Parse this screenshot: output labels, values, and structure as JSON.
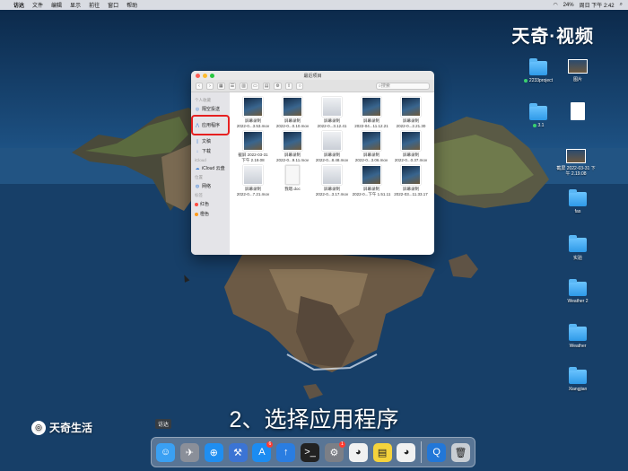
{
  "menubar": {
    "app_name": "访达",
    "items": [
      "文件",
      "编辑",
      "显示",
      "前往",
      "窗口",
      "帮助"
    ],
    "battery": "24%",
    "datetime": "周日 下午 2:42"
  },
  "watermark_top": "天奇·视频",
  "watermark_bottom": "天奇生活",
  "desktop": {
    "items": [
      {
        "label": "2233project"
      },
      {
        "label": "图片"
      },
      {
        "label": "3.1"
      },
      {
        "label": "截屏 2022-03-31 下午 2.19.08"
      },
      {
        "label": "fas"
      },
      {
        "label": "实验"
      },
      {
        "label": "Weather 2"
      },
      {
        "label": "Weather"
      },
      {
        "label": "Xiangjian"
      }
    ]
  },
  "finder": {
    "title": "最近项目",
    "search_placeholder": "搜索",
    "sidebar": {
      "favorites_header": "个人收藏",
      "airdrop": "隔空投送",
      "applications": "应用程序",
      "documents": "文稿",
      "downloads": "下载",
      "icloud_header": "iCloud",
      "icloud_drive": "iCloud 云盘",
      "locations_header": "位置",
      "network": "网络",
      "tags_header": "标签",
      "tag_red": "红色",
      "tag_orange": "橙色"
    },
    "files": [
      {
        "name": "屏幕录制",
        "sub": "2022-0...3.53.mov",
        "kind": "video"
      },
      {
        "name": "屏幕录制",
        "sub": "2022-0...0.10.mov",
        "kind": "video"
      },
      {
        "name": "屏幕录制",
        "sub": "2022-0...3.12.41",
        "kind": "video-light"
      },
      {
        "name": "屏幕录制",
        "sub": "2022-04...11.12.21",
        "kind": "video"
      },
      {
        "name": "屏幕录制",
        "sub": "2022-0...2.21.30",
        "kind": "video"
      },
      {
        "name": "截屏 2022-03-31",
        "sub": "下午 2.19.08",
        "kind": "video"
      },
      {
        "name": "屏幕录制",
        "sub": "2022-0...9.11.mov",
        "kind": "video"
      },
      {
        "name": "屏幕录制",
        "sub": "2022-0...8.48.mov",
        "kind": "video-light"
      },
      {
        "name": "屏幕录制",
        "sub": "2022-0...3.06.mov",
        "kind": "video"
      },
      {
        "name": "屏幕录制",
        "sub": "2022-0...0.37.mov",
        "kind": "video"
      },
      {
        "name": "屏幕录制",
        "sub": "2022-0...7.21.mov",
        "kind": "video-light"
      },
      {
        "name": "我嗯.doc",
        "sub": "",
        "kind": "doc"
      },
      {
        "name": "屏幕录制",
        "sub": "2022-0...3.17.mov",
        "kind": "video-light"
      },
      {
        "name": "屏幕录制",
        "sub": "2022-0...下午 1.51.11",
        "kind": "video"
      },
      {
        "name": "屏幕录制",
        "sub": "2022-03...11.33.17",
        "kind": "video"
      }
    ]
  },
  "subtitle": "2、选择应用程序",
  "dock": {
    "tooltip": "访达",
    "apps": [
      {
        "icon": "finder-icon",
        "glyph": "☺",
        "color": "#3aa0f3"
      },
      {
        "icon": "launchpad-icon",
        "glyph": "✈",
        "color": "#8a8f99"
      },
      {
        "icon": "safari-icon",
        "glyph": "⊕",
        "color": "#1f8ef1"
      },
      {
        "icon": "xcode-icon",
        "glyph": "⚒",
        "color": "#3b74d4"
      },
      {
        "icon": "app-store-icon",
        "glyph": "A",
        "color": "#1b8cf2",
        "badge": "6"
      },
      {
        "icon": "software-update-icon",
        "glyph": "↑",
        "color": "#2a7de1"
      },
      {
        "icon": "terminal-icon",
        "glyph": ">_",
        "color": "#222222"
      },
      {
        "icon": "system-preferences-icon",
        "glyph": "⚙",
        "color": "#7c7f86",
        "badge": "1"
      },
      {
        "icon": "qq-icon",
        "glyph": "◕",
        "color": "#f1f1f1"
      },
      {
        "icon": "notes-icon",
        "glyph": "▤",
        "color": "#f5d33c"
      },
      {
        "icon": "qq-2-icon",
        "glyph": "◕",
        "color": "#f1f1f1"
      },
      {
        "icon": "quicktime-icon",
        "glyph": "Q",
        "color": "#2277d8"
      },
      {
        "icon": "trash-icon",
        "glyph": "🗑",
        "color": "#c9ced4"
      }
    ]
  }
}
